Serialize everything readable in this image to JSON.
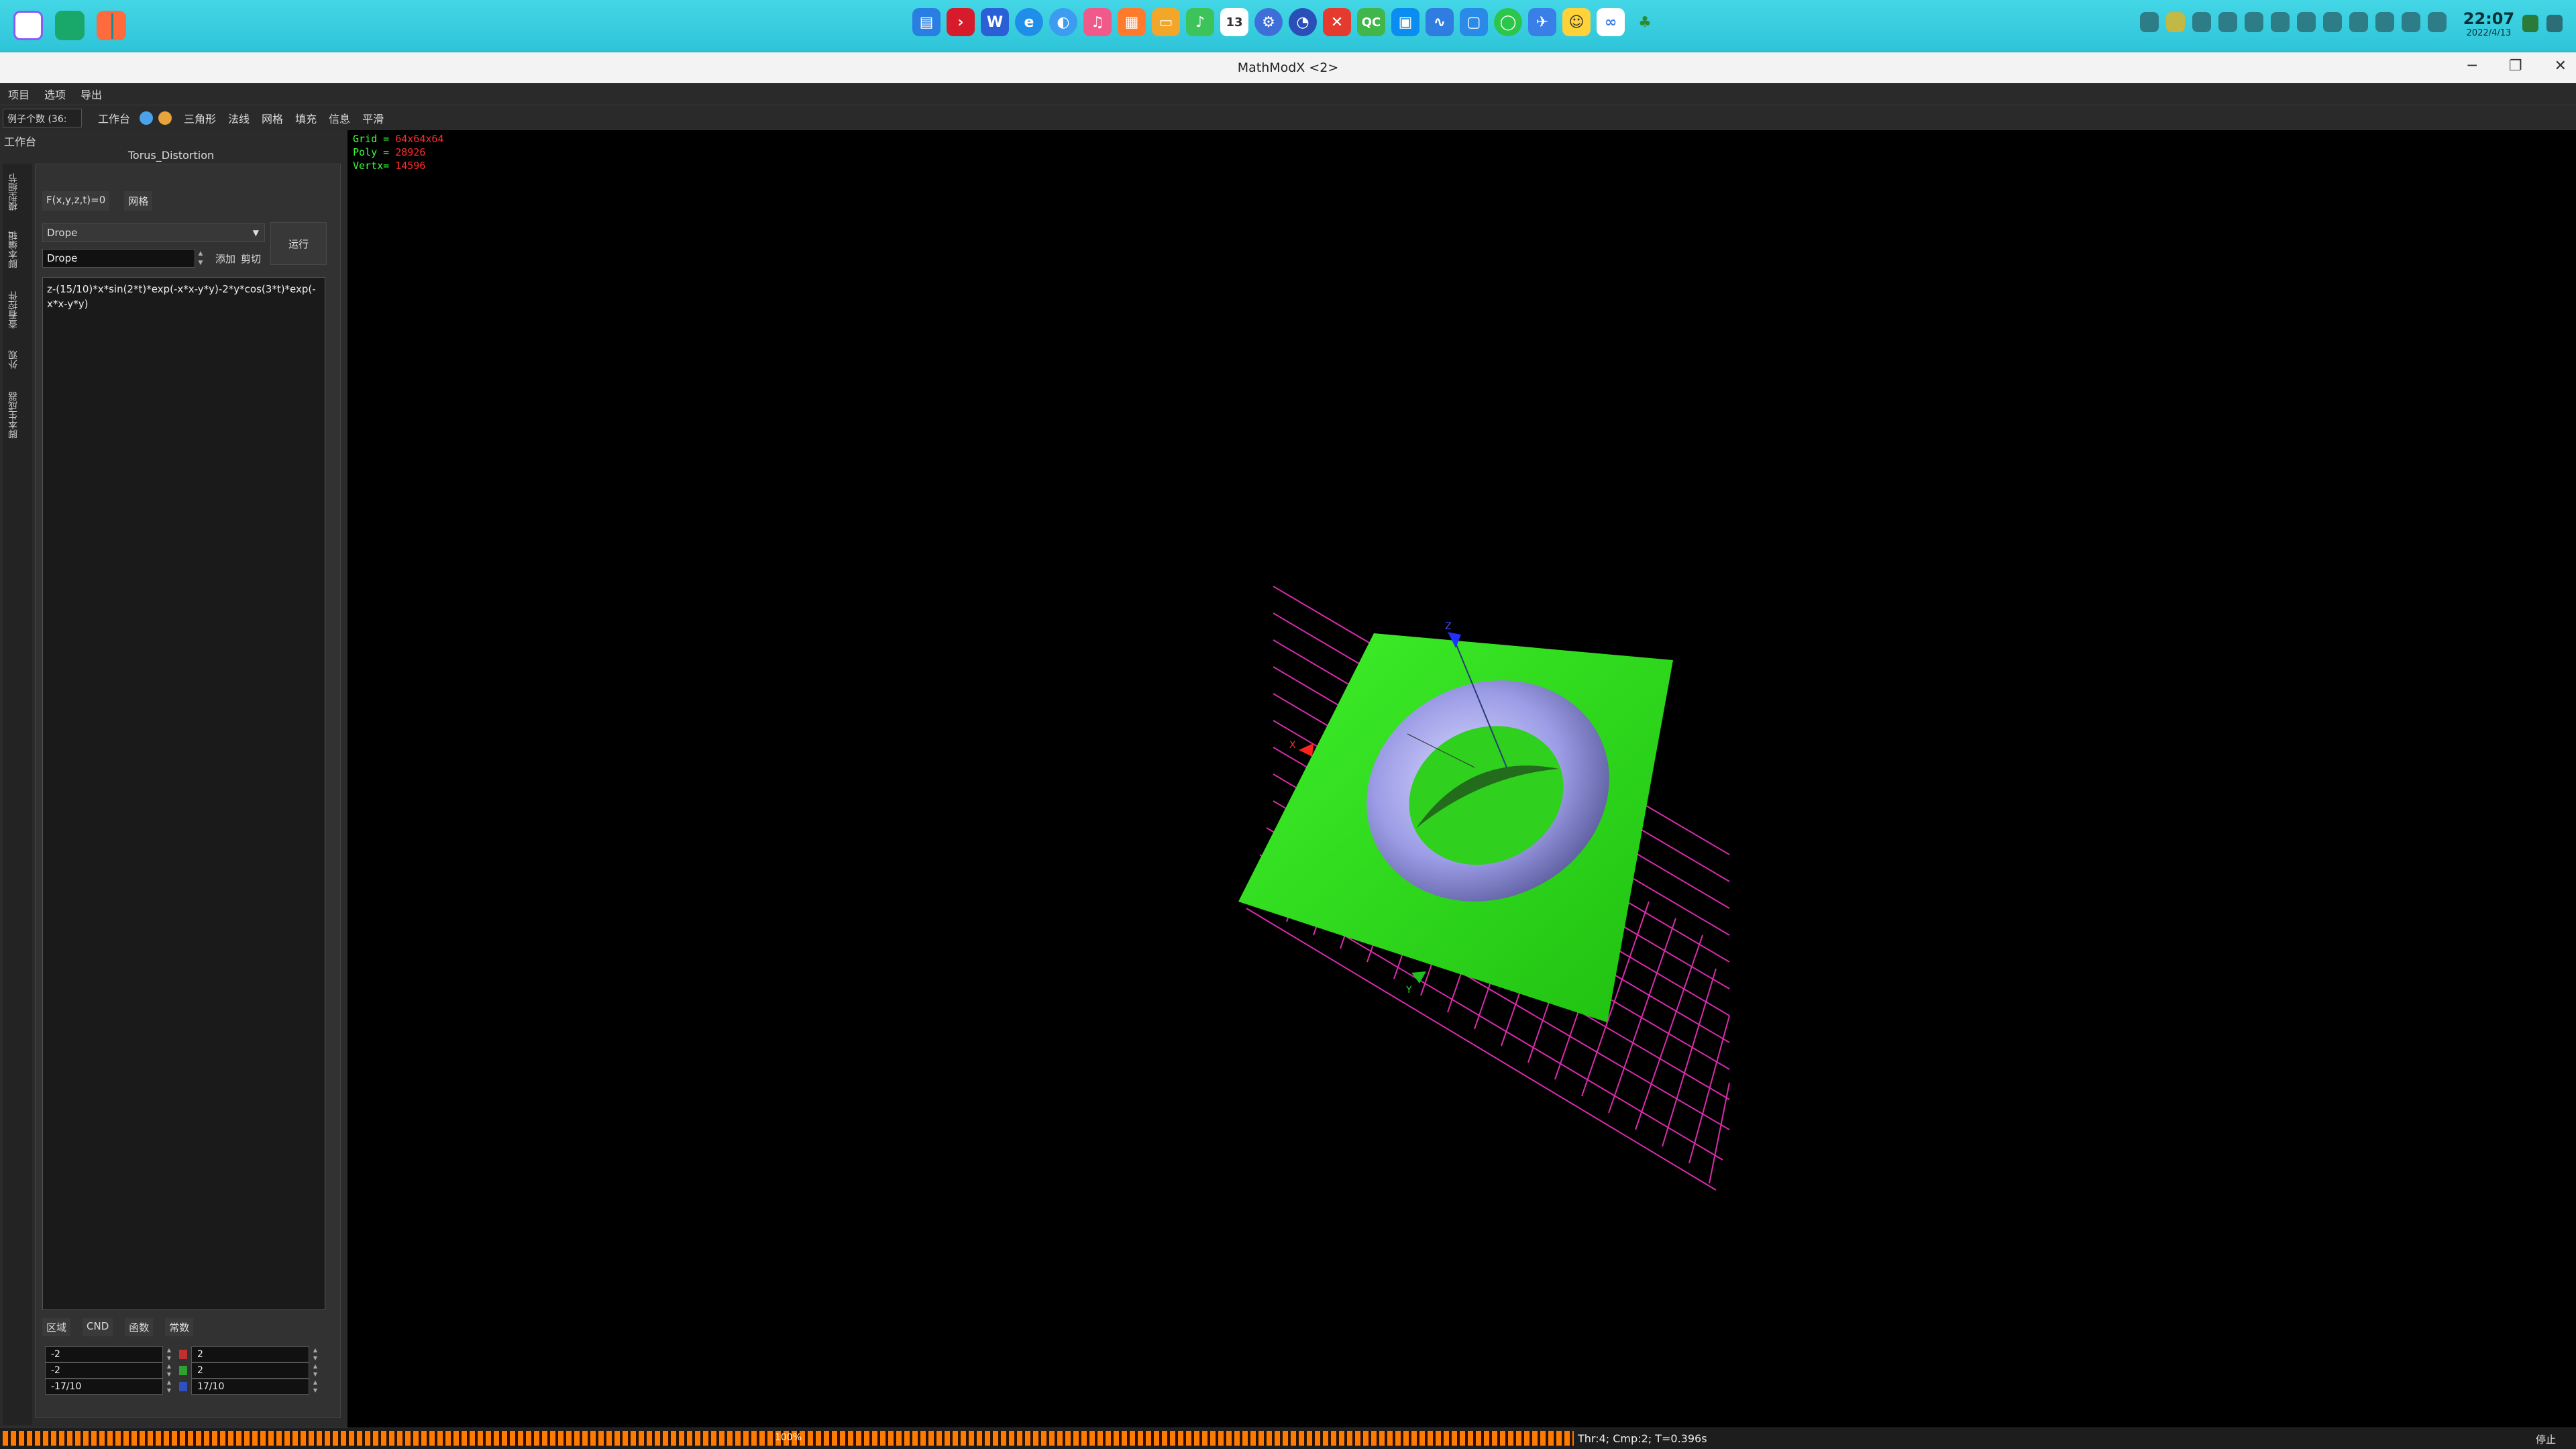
{
  "window": {
    "title": "MathModX <2>",
    "minimize": "─",
    "restore": "❐",
    "close": "✕"
  },
  "menu": [
    "项目",
    "选项",
    "导出"
  ],
  "toolbar": {
    "combo": "例子个数 (36:",
    "workbench": "工作台",
    "buttons": [
      "三角形",
      "法线",
      "网格",
      "填充",
      "信息",
      "平滑"
    ]
  },
  "left_panel": {
    "header": "工作台",
    "model_name": "Torus_Distortion",
    "vtabs": [
      "模型细节",
      "脚本编辑",
      "查看控件",
      "外观",
      "脚本生成器"
    ],
    "tabs": [
      "F(x,y,z,t)=0",
      "网格"
    ],
    "dropdown": "Drope",
    "run": "运行",
    "input_value": "Drope",
    "add": "添加",
    "cut": "剪切",
    "expression": "z-(15/10)*x*sin(2*t)*exp(-x*x-y*y)-2*y*cos(3*t)*exp(-x*x-y*y)",
    "bottom_tabs": [
      "区域",
      "CND",
      "函数",
      "常数"
    ],
    "ranges": [
      {
        "min": "-2",
        "max": "2"
      },
      {
        "min": "-2",
        "max": "2"
      },
      {
        "min": "-17/10",
        "max": "17/10"
      }
    ]
  },
  "hud": {
    "grid_label": "Grid = ",
    "grid_value": "64x64x64",
    "poly_label": "Poly = ",
    "poly_value": "28926",
    "vertex_label": "Vertx= ",
    "vertex_value": "14596"
  },
  "axes": {
    "x": "X",
    "y": "Y",
    "z": "Z"
  },
  "status": {
    "progress_text": "100%",
    "progress": 100,
    "info": "Thr:4; Cmp:2; T=0.396s",
    "stop": "停止"
  },
  "taskbar": {
    "time": "22:07",
    "date": "2022/4/13",
    "calendar_day": "13"
  },
  "colors": {
    "surface": "#33e61a",
    "torus": "#9c9ce6",
    "grid": "#ff33cc",
    "progress": "#ff7a00"
  }
}
